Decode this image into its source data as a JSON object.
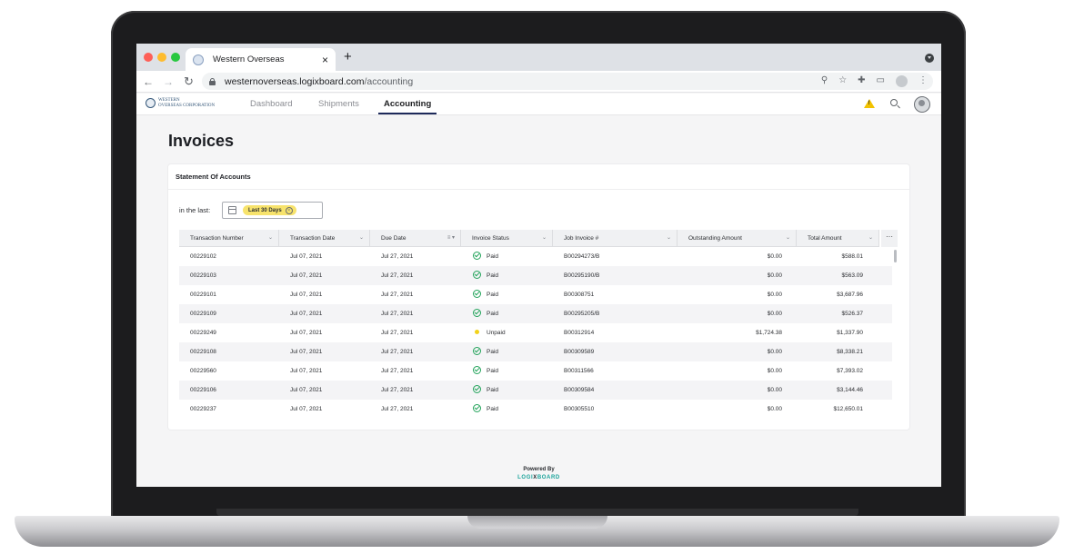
{
  "browser": {
    "tab_title": "Western Overseas",
    "tab_close": "×",
    "new_tab": "+",
    "url_host": "westernoverseas.logixboard.com",
    "url_path": "/accounting",
    "nav_icons": [
      "back-icon",
      "forward-icon",
      "reload-icon"
    ],
    "toolbar_icons": [
      "zoom-icon",
      "star-icon",
      "extensions-icon",
      "cast-icon",
      "profile-icon",
      "menu-icon"
    ]
  },
  "app": {
    "logo_text_line1": "WESTERN",
    "logo_text_line2": "OVERSEAS CORPORATION",
    "nav": [
      {
        "label": "Dashboard",
        "active": false
      },
      {
        "label": "Shipments",
        "active": false
      },
      {
        "label": "Accounting",
        "active": true
      }
    ],
    "accent_color": "#1e2a5a"
  },
  "page": {
    "title": "Invoices",
    "card_title": "Statement Of Accounts",
    "filter_label": "in the last:",
    "filter_chip": "Last 30 Days"
  },
  "table": {
    "columns": [
      "Transaction Number",
      "Transaction Date",
      "Due Date",
      "Invoice Status",
      "Job Invoice #",
      "Outstanding Amount",
      "Total Amount"
    ],
    "rows": [
      {
        "number": "00229102",
        "date": "Jul 07, 2021",
        "due": "Jul 27, 2021",
        "status": "Paid",
        "job": "B00294273/B",
        "outstanding": "$0.00",
        "total": "$588.01"
      },
      {
        "number": "00229103",
        "date": "Jul 07, 2021",
        "due": "Jul 27, 2021",
        "status": "Paid",
        "job": "B00295190/B",
        "outstanding": "$0.00",
        "total": "$563.09"
      },
      {
        "number": "00229101",
        "date": "Jul 07, 2021",
        "due": "Jul 27, 2021",
        "status": "Paid",
        "job": "B00308751",
        "outstanding": "$0.00",
        "total": "$3,687.96"
      },
      {
        "number": "00229109",
        "date": "Jul 07, 2021",
        "due": "Jul 27, 2021",
        "status": "Paid",
        "job": "B00295205/B",
        "outstanding": "$0.00",
        "total": "$526.37"
      },
      {
        "number": "00229249",
        "date": "Jul 07, 2021",
        "due": "Jul 27, 2021",
        "status": "Unpaid",
        "job": "B00312914",
        "outstanding": "$1,724.38",
        "total": "$1,337.90"
      },
      {
        "number": "00229108",
        "date": "Jul 07, 2021",
        "due": "Jul 27, 2021",
        "status": "Paid",
        "job": "B00309589",
        "outstanding": "$0.00",
        "total": "$8,338.21"
      },
      {
        "number": "00229560",
        "date": "Jul 07, 2021",
        "due": "Jul 27, 2021",
        "status": "Paid",
        "job": "B00311566",
        "outstanding": "$0.00",
        "total": "$7,393.02"
      },
      {
        "number": "00229106",
        "date": "Jul 07, 2021",
        "due": "Jul 27, 2021",
        "status": "Paid",
        "job": "B00309584",
        "outstanding": "$0.00",
        "total": "$3,144.46"
      },
      {
        "number": "00229237",
        "date": "Jul 07, 2021",
        "due": "Jul 27, 2021",
        "status": "Paid",
        "job": "B00305510",
        "outstanding": "$0.00",
        "total": "$12,650.01"
      }
    ],
    "status_colors": {
      "Paid": "#22a35a",
      "Unpaid": "#f2d21a"
    }
  },
  "footer": {
    "powered_by": "Powered By",
    "brand_a": "LOGI",
    "brand_b": "X",
    "brand_c": "BOARD"
  }
}
